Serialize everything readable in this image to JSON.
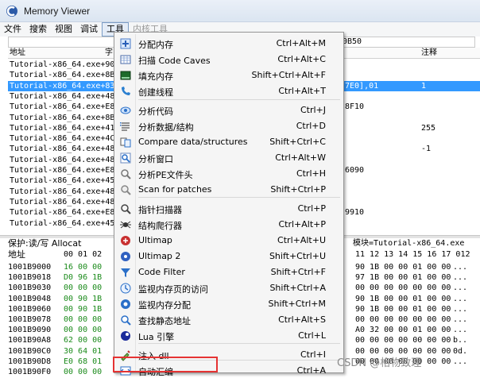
{
  "window": {
    "title": "Memory Viewer"
  },
  "menubar": {
    "items": [
      "文件",
      "搜索",
      "视图",
      "调试",
      "工具",
      "内核工具"
    ]
  },
  "disasm": {
    "addr_value": "0B50",
    "headers": [
      "地址",
      "字",
      "注释"
    ],
    "rows": [
      {
        "addr": "Tutorial-x86_64.exe+90",
        "mid": "",
        "cmt": ""
      },
      {
        "addr": "Tutorial-x86_64.exe+8B",
        "mid": "",
        "cmt": ""
      },
      {
        "addr": "Tutorial-x86_64.exe+83",
        "mid": "7E0],01",
        "cmt": "1"
      },
      {
        "addr": "Tutorial-x86_64.exe+48",
        "mid": "",
        "cmt": ""
      },
      {
        "addr": "Tutorial-x86_64.exe+E8",
        "mid": "8F10",
        "cmt": ""
      },
      {
        "addr": "Tutorial-x86_64.exe+8B",
        "mid": "",
        "cmt": ""
      },
      {
        "addr": "Tutorial-x86_64.exe+41",
        "mid": "",
        "cmt": "255"
      },
      {
        "addr": "Tutorial-x86_64.exe+4C",
        "mid": "",
        "cmt": ""
      },
      {
        "addr": "Tutorial-x86_64.exe+48",
        "mid": "",
        "cmt": "-1"
      },
      {
        "addr": "Tutorial-x86_64.exe+48",
        "mid": "",
        "cmt": ""
      },
      {
        "addr": "Tutorial-x86_64.exe+E8",
        "mid": "6090",
        "cmt": ""
      },
      {
        "addr": "Tutorial-x86_64.exe+45",
        "mid": "",
        "cmt": ""
      },
      {
        "addr": "Tutorial-x86_64.exe+48",
        "mid": "",
        "cmt": ""
      },
      {
        "addr": "Tutorial-x86_64.exe+48",
        "mid": "",
        "cmt": ""
      },
      {
        "addr": "Tutorial-x86_64.exe+E8",
        "mid": "9910",
        "cmt": ""
      },
      {
        "addr": "Tutorial-x86_64.exe+45",
        "mid": "",
        "cmt": ""
      }
    ]
  },
  "hex": {
    "info": "保护:读/写  Allocat",
    "module": "模块=Tutorial-x86_64.exe",
    "header_addr": "地址",
    "header_left": "00 01 02",
    "header_right": "11 12 13 14 15 16 17 012",
    "rows": [
      {
        "addr": "1001B9000",
        "bytes": "16 00 00",
        "right": "90 1B 00 00 01 00 00",
        "ascii": "..."
      },
      {
        "addr": "1001B9018",
        "bytes": "D0 96 1B",
        "right": "97 1B 00 00 01 00 00",
        "ascii": "..."
      },
      {
        "addr": "1001B9030",
        "bytes": "00 00 00",
        "right": "00 00 00 00 00 00 00",
        "ascii": "..."
      },
      {
        "addr": "1001B9048",
        "bytes": "00 90 1B",
        "right": "90 1B 00 00 01 00 00",
        "ascii": "..."
      },
      {
        "addr": "1001B9060",
        "bytes": "00 90 1B",
        "right": "90 1B 00 00 01 00 00",
        "ascii": "..."
      },
      {
        "addr": "1001B9078",
        "bytes": "00 00 00",
        "right": "00 00 00 00 00 00 00",
        "ascii": "..."
      },
      {
        "addr": "1001B9090",
        "bytes": "00 00 00",
        "right": "A0 32 00 00 01 00 00",
        "ascii": "..."
      },
      {
        "addr": "1001B90A8",
        "bytes": "62 00 00",
        "right": "00 00 00 00 00 00 00",
        "ascii": "b.."
      },
      {
        "addr": "1001B90C0",
        "bytes": "30 64 01",
        "right": "00 00 00 00 00 00 00",
        "ascii": "0d."
      },
      {
        "addr": "1001B90D8",
        "bytes": "E0 68 01",
        "right": "00 00 00 00 00 00 00",
        "ascii": "..."
      },
      {
        "addr": "1001B90F0",
        "bytes": "00 00 00",
        "right": "",
        "ascii": ""
      }
    ]
  },
  "popup": {
    "items": [
      {
        "label": "分配内存",
        "shortcut": "Ctrl+Alt+M",
        "icon": "plus-icon"
      },
      {
        "label": "扫描 Code Caves",
        "shortcut": "Ctrl+Alt+C",
        "icon": "scan-grid-icon"
      },
      {
        "label": "填充内存",
        "shortcut": "Shift+Ctrl+Alt+F",
        "icon": "fill-icon"
      },
      {
        "label": "创建线程",
        "shortcut": "Ctrl+Alt+T",
        "icon": "phone-icon"
      },
      {
        "label": "分析代码",
        "shortcut": "Ctrl+J",
        "icon": "eye-icon"
      },
      {
        "label": "分析数据/结构",
        "shortcut": "Ctrl+D",
        "icon": "list-icon"
      },
      {
        "label": "Compare data/structures",
        "shortcut": "Shift+Ctrl+C",
        "icon": "compare-icon"
      },
      {
        "label": "分析窗口",
        "shortcut": "Ctrl+Alt+W",
        "icon": "magnifier-icon"
      },
      {
        "label": "分析PE文件头",
        "shortcut": "Ctrl+H",
        "icon": "pe-icon"
      },
      {
        "label": "Scan for patches",
        "shortcut": "Shift+Ctrl+P",
        "icon": "patch-scan-icon"
      },
      {
        "label": "指针扫描器",
        "shortcut": "Ctrl+P",
        "icon": "pointer-scan-icon"
      },
      {
        "label": "结构爬行器",
        "shortcut": "Ctrl+Alt+P",
        "icon": "spider-icon"
      },
      {
        "label": "Ultimap",
        "shortcut": "Ctrl+Alt+U",
        "icon": "ultimap-icon"
      },
      {
        "label": "Ultimap 2",
        "shortcut": "Shift+Ctrl+U",
        "icon": "ultimap2-icon"
      },
      {
        "label": "Code Filter",
        "shortcut": "Shift+Ctrl+F",
        "icon": "filter-icon"
      },
      {
        "label": "监视内存页的访问",
        "shortcut": "Shift+Ctrl+A",
        "icon": "watch-page-icon"
      },
      {
        "label": "监视内存分配",
        "shortcut": "Shift+Ctrl+M",
        "icon": "watch-alloc-icon"
      },
      {
        "label": "查找静态地址",
        "shortcut": "Ctrl+Alt+S",
        "icon": "find-static-icon"
      },
      {
        "label": "Lua 引擎",
        "shortcut": "Ctrl+L",
        "icon": "lua-icon"
      },
      {
        "label": "注入 dll",
        "shortcut": "Ctrl+I",
        "icon": "syringe-icon"
      },
      {
        "label": "自动汇编",
        "shortcut": "Ctrl+A",
        "icon": "auto-assemble-icon"
      }
    ]
  },
  "watermark": "CSDN @格物致理",
  "colors": {
    "selection": "#3399ff",
    "highlight_box": "#e53333",
    "hex_bytes": "#1a8a1a"
  }
}
